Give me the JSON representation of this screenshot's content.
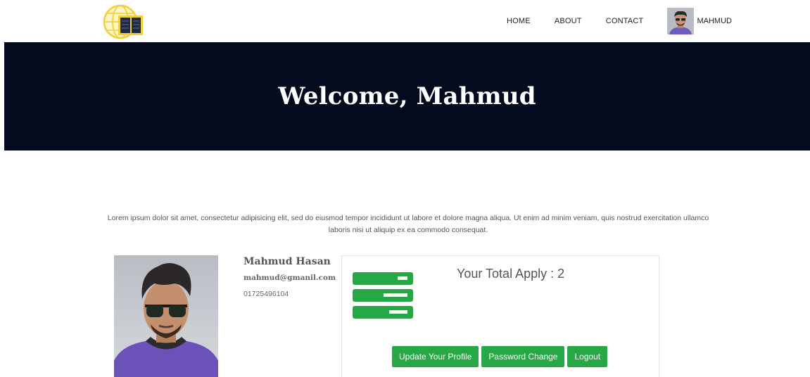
{
  "nav": {
    "links": [
      "HOME",
      "ABOUT",
      "CONTACT"
    ],
    "user_name": "MAHMUD"
  },
  "hero": {
    "title": "Welcome, Mahmud"
  },
  "intro": {
    "text": "Lorem ipsum dolor sit amet, consectetur adipisicing elit, sed do eiusmod tempor incididunt ut labore et dolore magna aliqua. Ut enim ad minim veniam, quis nostrud exercitation ullamco laboris nisi ut aliquip ex ea commodo consequat."
  },
  "profile": {
    "name": "Mahmud Hasan",
    "email": "mahmud@gmanil.com",
    "phone": "01725496104"
  },
  "card": {
    "apply_label": "Your Total Apply : 2",
    "icon": "list-stack-icon",
    "buttons": [
      "Update Your Profile",
      "Password Change",
      "Logout"
    ]
  },
  "colors": {
    "hero_bg": "#050b1e",
    "accent_green": "#28a745",
    "logo_yellow": "#f2cf3a",
    "logo_navy": "#1f2b44"
  }
}
